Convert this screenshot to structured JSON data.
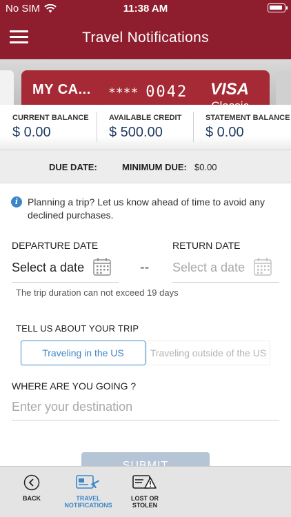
{
  "status_bar": {
    "carrier": "No SIM",
    "time": "11:38 AM"
  },
  "header": {
    "title": "Travel Notifications"
  },
  "card": {
    "name": "MY CA...",
    "masked": "****",
    "last_digits": "0042",
    "brand": "VISA",
    "subtitle": "Classic"
  },
  "balances": {
    "current": {
      "label": "CURRENT BALANCE",
      "value": "$ 0.00"
    },
    "available": {
      "label": "AVAILABLE CREDIT",
      "value": "$ 500.00"
    },
    "statement": {
      "label": "STATEMENT BALANCE",
      "value": "$ 0.00"
    }
  },
  "due": {
    "due_date_label": "DUE DATE:",
    "due_date_value": "",
    "minimum_due_label": "MINIMUM DUE:",
    "minimum_due_value": "$0.00"
  },
  "form": {
    "info_text": "Planning a trip? Let us know ahead of time to avoid any declined purchases.",
    "departure": {
      "label": "DEPARTURE DATE",
      "placeholder": "Select a date"
    },
    "return": {
      "label": "RETURN DATE",
      "placeholder": "Select a date"
    },
    "separator": "--",
    "duration_hint": "The trip duration can not exceed 19 days",
    "trip_label": "TELL US ABOUT YOUR TRIP",
    "trip_options": [
      "Traveling in the US",
      "Traveling outside of the US"
    ],
    "selected_trip_option": "Traveling in the US",
    "destination_label": "WHERE ARE YOU GOING ?",
    "destination_placeholder": "Enter your destination",
    "submit_label": "SUBMIT"
  },
  "bottom_nav": {
    "back": {
      "label": "BACK",
      "icon": "back-circle-icon"
    },
    "travel": {
      "label": "TRAVEL NOTIFICATIONS",
      "icon": "travel-card-icon"
    },
    "lost": {
      "label": "LOST OR STOLEN",
      "icon": "card-warning-icon"
    }
  },
  "colors": {
    "header": "#8e1e2e",
    "card": "#a52a35",
    "accent": "#3d86c6",
    "balance_value": "#1f3a5f",
    "submit_disabled": "#b5c5d6"
  }
}
